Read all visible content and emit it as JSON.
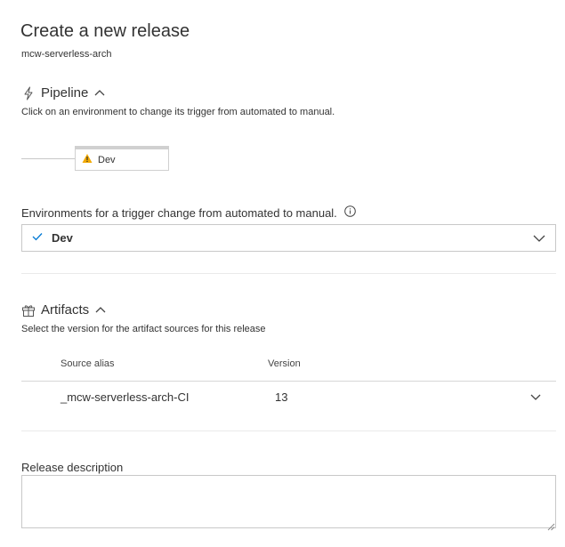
{
  "header": {
    "title": "Create a new release",
    "subtitle": "mcw-serverless-arch"
  },
  "pipeline": {
    "heading": "Pipeline",
    "hint": "Click on an environment to change its trigger from automated to manual.",
    "environment_card": "Dev",
    "environments_label": "Environments for a trigger change from automated to manual.",
    "selected_environment": "Dev"
  },
  "artifacts": {
    "heading": "Artifacts",
    "hint": "Select the version for the artifact sources for this release",
    "columns": [
      "Source alias",
      "Version"
    ],
    "rows": [
      {
        "source_alias": "_mcw-serverless-arch-CI",
        "version": "13"
      }
    ]
  },
  "description": {
    "label": "Release description",
    "value": ""
  },
  "colors": {
    "check_blue": "#0078d4",
    "warning_yellow": "#f2a900"
  }
}
